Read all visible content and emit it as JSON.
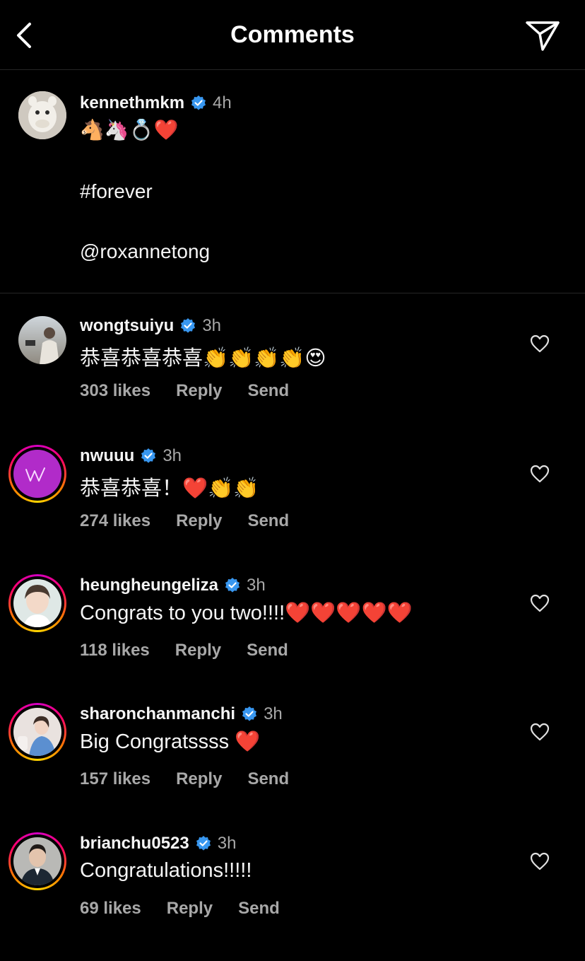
{
  "header": {
    "title": "Comments",
    "back_icon": "chevron-left-icon",
    "share_icon": "paper-plane-icon"
  },
  "caption": {
    "username": "kennethmkm",
    "time": "4h",
    "emoji_line": "🐴🦄💍❤️",
    "hashtag": "#forever",
    "mention": "@roxannetong"
  },
  "comments": [
    {
      "username": "wongtsuiyu",
      "time": "3h",
      "text": "恭喜恭喜恭喜👏👏👏👏😍",
      "likes": "303 likes",
      "reply": "Reply",
      "send": "Send"
    },
    {
      "username": "nwuuu",
      "time": "3h",
      "text": "恭喜恭喜！❤️👏👏",
      "likes": "274 likes",
      "reply": "Reply",
      "send": "Send"
    },
    {
      "username": "heungheungeliza",
      "time": "3h",
      "text": "Congrats to you two!!!!❤️❤️❤️❤️❤️",
      "likes": "118 likes",
      "reply": "Reply",
      "send": "Send"
    },
    {
      "username": "sharonchanmanchi",
      "time": "3h",
      "text": "Big Congratssss ❤️",
      "likes": "157 likes",
      "reply": "Reply",
      "send": "Send"
    },
    {
      "username": "brianchu0523",
      "time": "3h",
      "text": "Congratulations!!!!!",
      "likes": "69 likes",
      "reply": "Reply",
      "send": "Send"
    }
  ],
  "colors": {
    "background": "#000000",
    "verified": "#3897f0",
    "secondary_text": "#a8a8a8"
  }
}
